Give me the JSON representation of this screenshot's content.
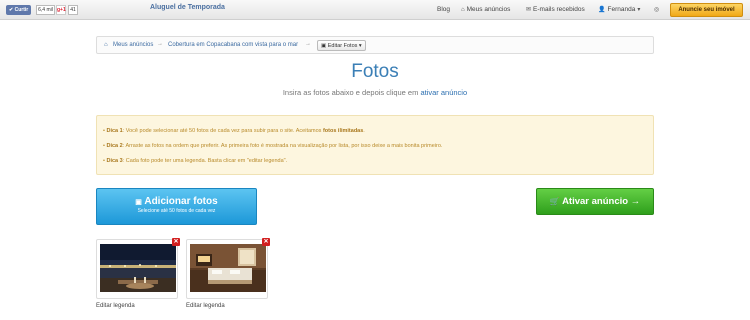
{
  "topbar": {
    "like_label": "✔ Curtir",
    "like_count": "6,4 mil",
    "gplus_label": "g+1",
    "gplus_count": "41",
    "brand": "Aluguel de Temporada",
    "nav": {
      "blog": "Blog",
      "listings": "Meus anúncios",
      "emails": "E-mails recebidos",
      "user": "Fernanda",
      "cta": "Anuncie seu imóvel"
    }
  },
  "breadcrumb": {
    "home": "Meus anúncios",
    "listing": "Cobertura em Copacabana com vista para o mar",
    "current": "Editar Fotos"
  },
  "page": {
    "title": "Fotos",
    "subtitle_prefix": "Insira as fotos abaixo e depois clique em",
    "subtitle_link": "ativar anúncio"
  },
  "tips": [
    {
      "label": "Dica 1",
      "text": ": Você pode selecionar até 50 fotos de cada vez para subir para o site. Aceitamos ",
      "bold": "fotos ilimitadas",
      "end": "."
    },
    {
      "label": "Dica 2",
      "text": ": Arraste as fotos na ordem que preferir. As primeira foto é mostrada na visualização por lista, por isso deixe a mais bonita primeiro.",
      "bold": "",
      "end": ""
    },
    {
      "label": "Dica 3",
      "text": ": Cada foto pode ter uma legenda. Basta clicar em \"editar legenda\".",
      "bold": "",
      "end": ""
    }
  ],
  "buttons": {
    "add_label": "Adicionar fotos",
    "add_sub": "Selecione até 50 fotos de cada vez",
    "activate_label": "Ativar anúncio →"
  },
  "photos": [
    {
      "caption": "Editar legenda",
      "delete": "✕"
    },
    {
      "caption": "Editar legenda",
      "delete": "✕"
    }
  ],
  "colors": {
    "title": "#3b7fb6",
    "add_button": "#1d98d8",
    "activate_button": "#2f9f1c",
    "cta": "#f1a817"
  }
}
